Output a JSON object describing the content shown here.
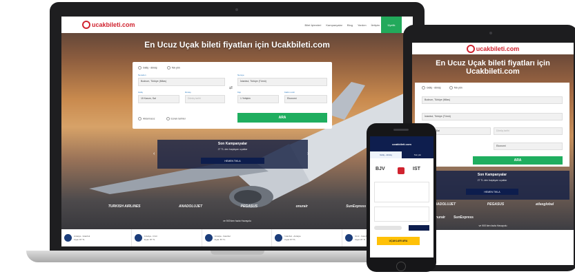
{
  "laptop": {
    "brand": "ucakbileti.com",
    "nav": [
      "Bilet İşlemleri",
      "Kampanyalar",
      "Blog",
      "Yardım",
      "İletişim"
    ],
    "nav_cta": "Üyelik",
    "hero_title": "En Ucuz Uçak bileti fiyatları için Ucakbileti.com",
    "trip_type": [
      "Gidiş - dönüş",
      "Tek yön"
    ],
    "fields": {
      "from_label": "Nereden",
      "from_value": "Bodrum, Türkiye (Milas)",
      "to_label": "Nereye",
      "to_value": "İstanbul, Türkiye (Tümü)",
      "depart_label": "Gidiş",
      "depart_value": "15 Kasım, Sal",
      "return_label": "Dönüş",
      "return_value": "Dönüş tarihi",
      "pax_label": "Kişi",
      "pax_value": "1 Yetişkin",
      "class_label": "Kabin sınıfı",
      "class_value": "Ekonomi"
    },
    "options": [
      "Aktarmasız",
      "Esnek tarihler"
    ],
    "search_button": "ARA",
    "promo": {
      "title": "Son Kampanyalar",
      "subtitle": "27 TL den başlayan uçaklar",
      "button": "HEMEN TIKLA"
    },
    "airlines": [
      "TURKISH AIRLINES",
      "ANADOLUJET",
      "PEGASUS",
      "onurair",
      "SunExpress"
    ],
    "caption": "ve 900'den fazla Havayolu",
    "routes": [
      {
        "route": "Antalya - İstanbul",
        "price": "Fiyat: 87 TL"
      },
      {
        "route": "Antalya - İzmir",
        "price": "Fiyat: 87 TL"
      },
      {
        "route": "Antalya - İstanbul",
        "price": "Fiyat: 87 TL"
      },
      {
        "route": "İstanbul - Antalya",
        "price": "Fiyat: 87 TL"
      },
      {
        "route": "İzmir - İstanbul",
        "price": "Fiyat: 87 TL"
      }
    ]
  },
  "tablet": {
    "brand": "ucakbileti.com",
    "hero_title": "En Ucuz Uçak bileti fiyatları için Ucakbileti.com",
    "trip_type": [
      "Gidiş - dönüş",
      "Tek yön"
    ],
    "from_value": "Bodrum, Türkiye (Milas)",
    "to_value": "İstanbul, Türkiye (Tümü)",
    "depart_value": "15 Kasım, Sal",
    "return_value": "Dönüş tarihi",
    "class_value": "Ekonomi",
    "search_button": "ARA",
    "promo_title": "Son Kampanyalar",
    "promo_subtitle": "27 TL den başlayan uçaklar",
    "promo_button": "HEMEN TIKLA",
    "airlines_row1": [
      "ANADOLUJET",
      "PEGASUS",
      "atlasglobal"
    ],
    "airlines_row2": [
      "Onurair",
      "SunExpress"
    ],
    "caption": "ve 900'den fazla Havayolu"
  },
  "phone": {
    "brand": "ucakbileti.com",
    "tabs": [
      "Gidiş - dönüş",
      "Tek yön"
    ],
    "from_code": "BJV",
    "to_code": "IST",
    "search_button": "UÇAKLARI ARA"
  }
}
